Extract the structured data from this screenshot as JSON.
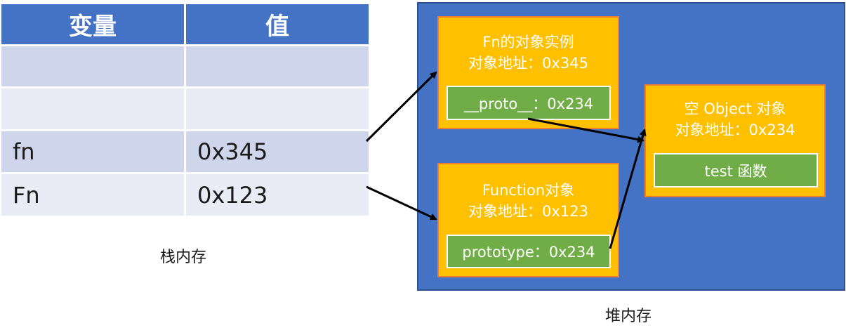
{
  "stack": {
    "headers": [
      "变量",
      "值"
    ],
    "rows": [
      {
        "name": "",
        "value": ""
      },
      {
        "name": "",
        "value": ""
      },
      {
        "name": "fn",
        "value": "0x345"
      },
      {
        "name": "Fn",
        "value": "0x123"
      }
    ],
    "caption": "栈内存"
  },
  "heap": {
    "caption": "堆内存",
    "fn_instance": {
      "line1": "Fn的对象实例",
      "line2": "对象地址：0x345",
      "slot": "__proto__：0x234"
    },
    "function_obj": {
      "line1": "Function对象",
      "line2": "对象地址：0x123",
      "slot": "prototype：0x234"
    },
    "empty_object": {
      "line1": "空 Object 对象",
      "line2": "对象地址：0x234",
      "slot": "test 函数"
    }
  },
  "colors": {
    "header": "#4472c4",
    "row_dark": "#cfd5ea",
    "row_light": "#e9ebf5",
    "heap_bg": "#4472c4",
    "object_fill": "#ffc000",
    "slot_fill": "#70ad47"
  }
}
